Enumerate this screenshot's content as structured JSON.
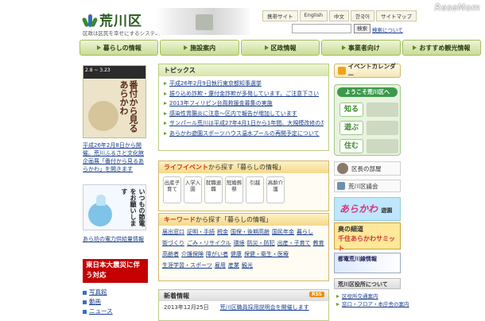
{
  "watermark": "ReseMom",
  "header": {
    "site_name": "荒川区",
    "tagline": "区政は区民を幸せにするシステム",
    "util_links": [
      "携帯サイト",
      "English",
      "中文",
      "한국어",
      "サイトマップ"
    ],
    "search_button": "検索",
    "search_howto": "検索について"
  },
  "nav": [
    "暮らしの情報",
    "施設案内",
    "区政情報",
    "事業者向け",
    "おすすめ観光情報"
  ],
  "left": {
    "banner_strip": "2.8 ~ 3.23",
    "banner_title": "番付から見る あらかわ",
    "banner_caption": "平成26年2月8日から開催。荒川ふるさと文化館企画展「番付から見るあらかわ」を開きます",
    "poster_text": "いつもの節電をお願いします",
    "poster_caption": "あら坊の電力供給量情報",
    "disaster_label": "東日本大震災に伴う対応",
    "links": [
      "写真館",
      "動画",
      "ニュース"
    ]
  },
  "topics": {
    "title": "トピックス",
    "items": [
      "平成26年2月9日執行東京都知事選挙",
      "振り込め詐欺・還付金詐欺が多発しています。ご注意下さい",
      "2013年フィリピン台風救援金募集の実施",
      "感染性胃腸炎に注意～区内で報告が増加しています",
      "サンパール荒川は平成27年4月1日から1年間、大規模改修のため全館休館します",
      "あらかわ遊園スポーツハウス温水プールの再開予定について"
    ]
  },
  "life_event": {
    "title": "ライフイベント",
    "suffix": "から探す「暮らしの情報」",
    "items": [
      "出産子育て",
      "入学入園",
      "就職退職",
      "冠婚葬祭",
      "引越",
      "高齢介護"
    ]
  },
  "keyword": {
    "title": "キーワード",
    "suffix": "から探す「暮らしの情報」",
    "items": [
      "届出窓口",
      "証明・手続",
      "税金",
      "国保・後期高齢",
      "国民年金",
      "暮らし",
      "街づくり",
      "ごみ・リサイクル",
      "環境",
      "防災・防犯",
      "出産・子育て",
      "教育",
      "高齢者",
      "介護保険",
      "障がい者",
      "健康",
      "保健・衛生・医療",
      "生涯学習・スポーツ",
      "雇用",
      "産業",
      "観光"
    ]
  },
  "news": {
    "title": "新着情報",
    "rss": "RSS",
    "rows": [
      {
        "date": "2013年12月25日",
        "text": "荒川区職員採用説明会を開催します"
      }
    ]
  },
  "right": {
    "event_calendar": "イベントカレンダー",
    "welcome_title": "ようこそ荒川区へ",
    "welcome_items": [
      "知る",
      "遊ぶ",
      "住む"
    ],
    "mayor": "区長の部屋",
    "council": "荒川区議会",
    "yuen_text": "あらかわ",
    "yuen_sub": "遊園",
    "summit_line1": "奥の細道",
    "summit_line2": "千住あらかわサミット",
    "rail_text": "都電荒川線情報",
    "office_title": "荒川区役所について",
    "office_links": [
      "区役所交通案内",
      "窓口・フロア・本庁舎の案内"
    ]
  }
}
